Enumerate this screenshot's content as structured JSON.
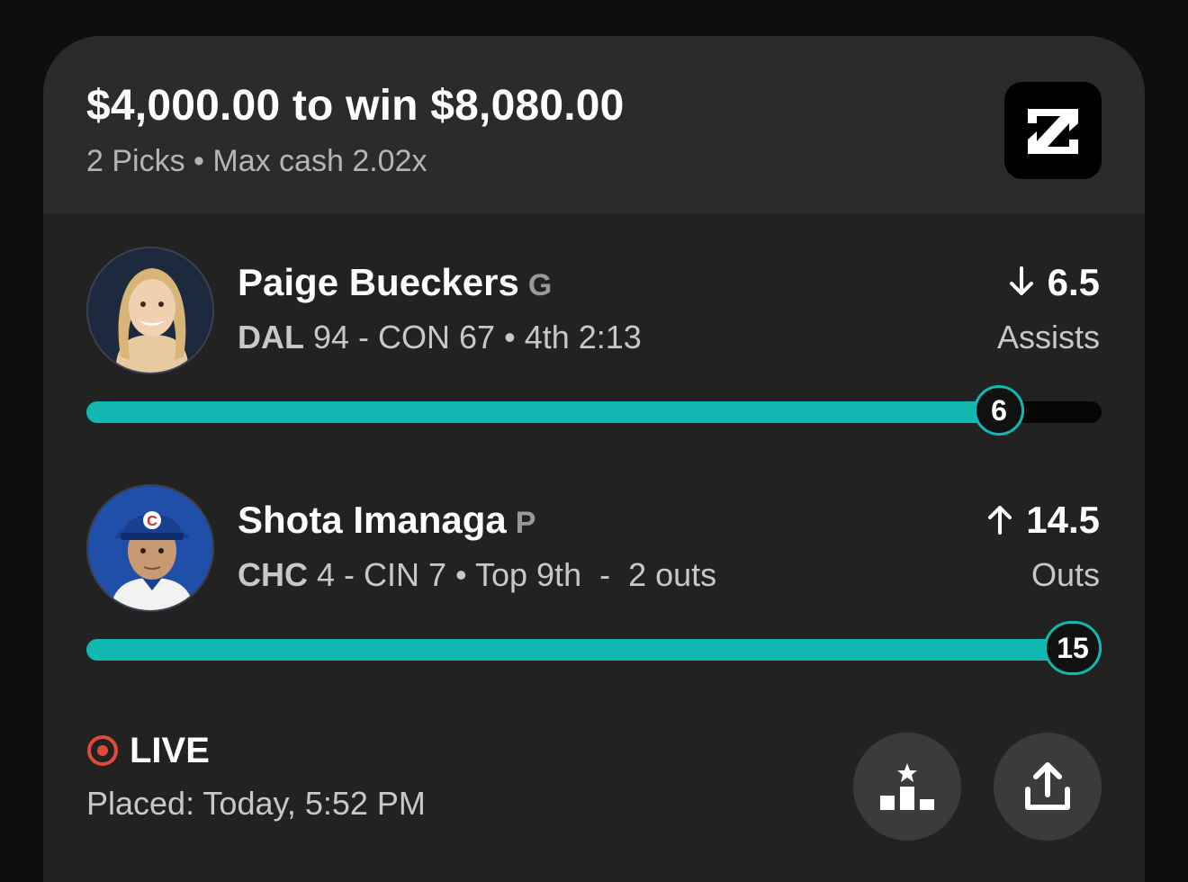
{
  "header": {
    "headline": "$4,000.00 to win $8,080.00",
    "subline": "2 Picks • Max cash 2.02x",
    "logo_icon": "brand-logo-icon"
  },
  "picks": [
    {
      "player": "Paige Bueckers",
      "position": "G",
      "team_a": "DAL",
      "game_rest": " 94 - CON 67 • 4th 2:13",
      "direction": "under",
      "arrow_icon": "arrow-down-icon",
      "line": "6.5",
      "stat": "Assists",
      "current": "6",
      "progress": 0.899
    },
    {
      "player": "Shota Imanaga",
      "position": "P",
      "team_a": "CHC",
      "game_rest": " 4 - CIN 7 • Top 9th  -  2 outs",
      "direction": "over",
      "arrow_icon": "arrow-up-icon",
      "line": "14.5",
      "stat": "Outs",
      "current": "15",
      "progress": 1.0
    }
  ],
  "footer": {
    "status": "LIVE",
    "placed": "Placed: Today, 5:52 PM",
    "leaderboard_icon": "leaderboard-icon",
    "share_icon": "share-icon"
  },
  "colors": {
    "accent": "#13b8b3",
    "live": "#e0493f",
    "card": "#222222",
    "header": "#2b2b2b"
  }
}
